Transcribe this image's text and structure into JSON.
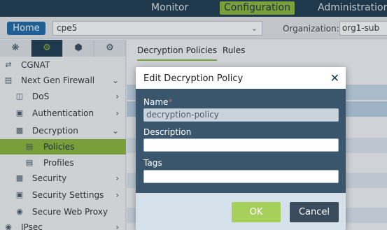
{
  "topnav": {
    "monitor": "Monitor",
    "configuration": "Configuration",
    "administration": "Administration"
  },
  "subbar": {
    "home": "Home",
    "appliance": "cpe5",
    "org_label": "Organization:",
    "org_value": "org1-sub"
  },
  "sidebar": {
    "items": [
      {
        "label": "CGNAT",
        "icon": "cgnat-icon"
      },
      {
        "label": "Next Gen Firewall",
        "icon": "firewall-icon",
        "expanded": true
      },
      {
        "label": "DoS",
        "icon": "dos-icon"
      },
      {
        "label": "Authentication",
        "icon": "authentication-icon"
      },
      {
        "label": "Decryption",
        "icon": "lock-icon",
        "expanded": true
      },
      {
        "label": "Policies",
        "icon": "policy-icon",
        "selected": true
      },
      {
        "label": "Profiles",
        "icon": "profiles-icon"
      },
      {
        "label": "Security",
        "icon": "security-icon"
      },
      {
        "label": "Security Settings",
        "icon": "security-settings-icon"
      },
      {
        "label": "Secure Web Proxy",
        "icon": "globe-icon"
      },
      {
        "label": "IPsec",
        "icon": "ipsec-icon"
      }
    ]
  },
  "main": {
    "tabs": [
      "Decryption Policies",
      "Rules"
    ]
  },
  "modal": {
    "title": "Edit Decryption Policy",
    "name_label": "Name",
    "name_required": "*",
    "name_value": "decryption-policy",
    "description_label": "Description",
    "description_value": "",
    "tags_label": "Tags",
    "tags_value": "",
    "ok": "OK",
    "cancel": "Cancel"
  },
  "colors": {
    "accent": "#8ab83a",
    "navy": "#1f3a4f",
    "modal_body": "#3a566d"
  }
}
